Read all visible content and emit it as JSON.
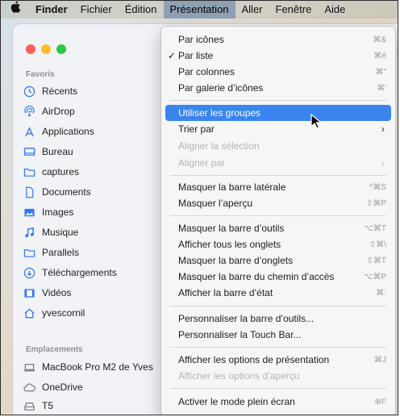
{
  "menubar": {
    "apple": "",
    "items": [
      "Finder",
      "Fichier",
      "Édition",
      "Présentation",
      "Aller",
      "Fenêtre",
      "Aide"
    ]
  },
  "sidebar": {
    "favorites_header": "Favoris",
    "favorites": [
      {
        "label": "Récents",
        "icon": "clock-icon"
      },
      {
        "label": "AirDrop",
        "icon": "airdrop-icon"
      },
      {
        "label": "Applications",
        "icon": "applications-icon"
      },
      {
        "label": "Bureau",
        "icon": "desktop-icon"
      },
      {
        "label": "captures",
        "icon": "folder-icon"
      },
      {
        "label": "Documents",
        "icon": "document-icon"
      },
      {
        "label": "Images",
        "icon": "photo-icon"
      },
      {
        "label": "Musique",
        "icon": "music-icon"
      },
      {
        "label": "Parallels",
        "icon": "folder-icon"
      },
      {
        "label": "Téléchargements",
        "icon": "download-icon"
      },
      {
        "label": "Vidéos",
        "icon": "film-icon"
      },
      {
        "label": "yvescornil",
        "icon": "home-icon"
      }
    ],
    "locations_header": "Emplacements",
    "locations": [
      {
        "label": "MacBook Pro M2 de Yves",
        "icon": "laptop-icon"
      },
      {
        "label": "OneDrive",
        "icon": "cloud-icon"
      },
      {
        "label": "T5",
        "icon": "drive-icon"
      }
    ]
  },
  "menu": {
    "items": [
      {
        "label": "Par icônes",
        "shortcut": "⌘&"
      },
      {
        "label": "Par liste",
        "shortcut": "⌘é",
        "checked": "✓"
      },
      {
        "label": "Par colonnes",
        "shortcut": "⌘\""
      },
      {
        "label": "Par galerie d’icônes",
        "shortcut": "⌘'"
      },
      {
        "label": "Utiliser les groupes",
        "shortcut": ""
      },
      {
        "label": "Trier par",
        "submenu": "›"
      },
      {
        "label": "Aligner la sélection",
        "shortcut": ""
      },
      {
        "label": "Aligner par",
        "submenu": "›"
      },
      {
        "label": "Masquer la barre latérale",
        "shortcut": "^⌘S"
      },
      {
        "label": "Masquer l’aperçu",
        "shortcut": "⇧⌘P"
      },
      {
        "label": "Masquer la barre d’outils",
        "shortcut": "⌥⌘T"
      },
      {
        "label": "Afficher tous les onglets",
        "shortcut": "⇧⌘\\"
      },
      {
        "label": "Masquer la barre d’onglets",
        "shortcut": "⇧⌘T"
      },
      {
        "label": "Masquer la barre du chemin d’accès",
        "shortcut": "⌥⌘P"
      },
      {
        "label": "Afficher la barre d’état",
        "shortcut": "⌘:"
      },
      {
        "label": "Personnaliser la barre d’outils...",
        "shortcut": ""
      },
      {
        "label": "Personnaliser la Touch Bar...",
        "shortcut": ""
      },
      {
        "label": "Afficher les options de présentation",
        "shortcut": "⌘J"
      },
      {
        "label": "Afficher les options d’aperçu",
        "shortcut": ""
      },
      {
        "label": "Activer le mode plein écran",
        "shortcut": "⊕F"
      }
    ]
  },
  "window_edge_text": "›",
  "colors": {
    "highlight": "#3a84f0",
    "accent": "#3478f6"
  }
}
